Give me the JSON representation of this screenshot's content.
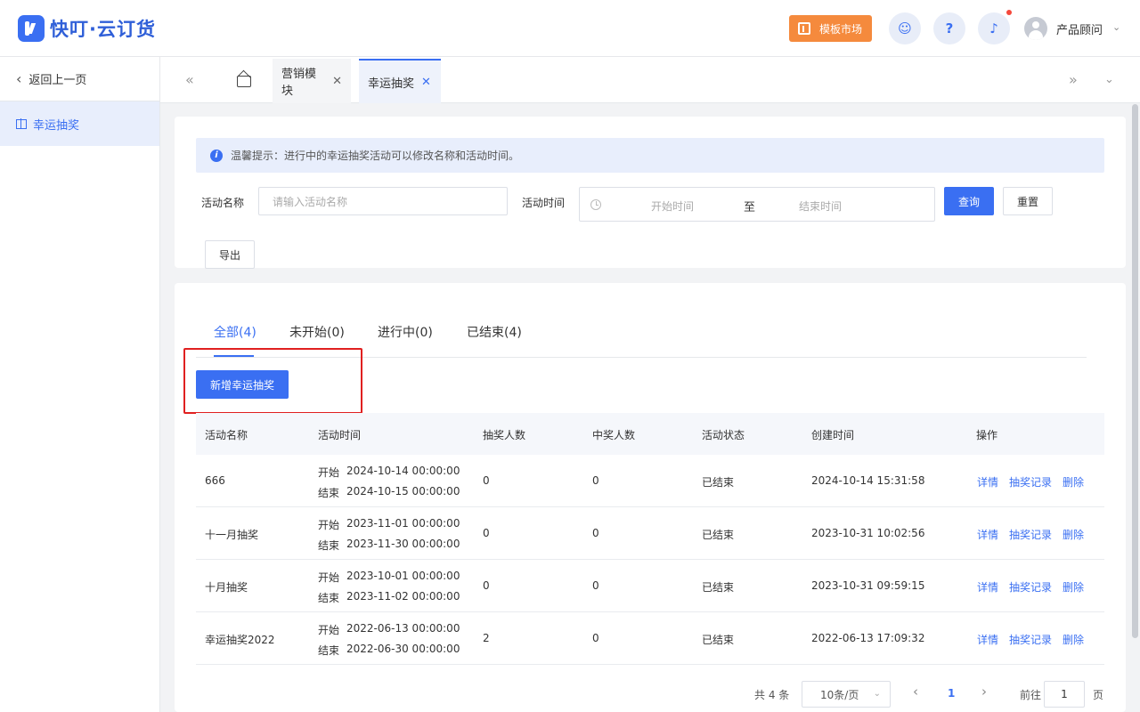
{
  "app": {
    "logo_text": "快叮·云订货",
    "market_button": "模板市场",
    "user_name": "产品顾问"
  },
  "sidebar": {
    "back_label": "返回上一页",
    "items": [
      {
        "label": "幸运抽奖",
        "icon": "gift-icon"
      }
    ]
  },
  "tabs": [
    {
      "label": "营销模块"
    },
    {
      "label": "幸运抽奖"
    }
  ],
  "filter": {
    "notice": "温馨提示：进行中的幸运抽奖活动可以修改名称和活动时间。",
    "name_label": "活动名称",
    "name_placeholder": "请输入活动名称",
    "time_label": "活动时间",
    "start_placeholder": "开始时间",
    "range_separator": "至",
    "end_placeholder": "结束时间",
    "search_button": "查询",
    "reset_button": "重置",
    "export_button": "导出"
  },
  "status_tabs": [
    {
      "label": "全部(4)"
    },
    {
      "label": "未开始(0)"
    },
    {
      "label": "进行中(0)"
    },
    {
      "label": "已结束(4)"
    }
  ],
  "add_button": "新增幸运抽奖",
  "table": {
    "columns": [
      "活动名称",
      "活动时间",
      "抽奖人数",
      "中奖人数",
      "活动状态",
      "创建时间",
      "操作"
    ],
    "start_prefix": "开始",
    "end_prefix": "结束",
    "actions": {
      "detail": "详情",
      "records": "抽奖记录",
      "delete": "删除"
    },
    "rows": [
      {
        "name": "666",
        "start": "2024-10-14 00:00:00",
        "end": "2024-10-15 00:00:00",
        "draw_count": "0",
        "win_count": "0",
        "status": "已结束",
        "created": "2024-10-14 15:31:58"
      },
      {
        "name": "十一月抽奖",
        "start": "2023-11-01 00:00:00",
        "end": "2023-11-30 00:00:00",
        "draw_count": "0",
        "win_count": "0",
        "status": "已结束",
        "created": "2023-10-31 10:02:56"
      },
      {
        "name": "十月抽奖",
        "start": "2023-10-01 00:00:00",
        "end": "2023-11-02 00:00:00",
        "draw_count": "0",
        "win_count": "0",
        "status": "已结束",
        "created": "2023-10-31 09:59:15"
      },
      {
        "name": "幸运抽奖2022",
        "start": "2022-06-13 00:00:00",
        "end": "2022-06-30 00:00:00",
        "draw_count": "2",
        "win_count": "0",
        "status": "已结束",
        "created": "2022-06-13 17:09:32"
      }
    ]
  },
  "pagination": {
    "total": "共 4 条",
    "page_size": "10条/页",
    "current_page": "1",
    "goto_label": "前往",
    "goto_value": "1",
    "page_suffix": "页"
  },
  "colors": {
    "primary": "#3a6ff2",
    "market": "#f58a3d",
    "highlight_box": "#e02020"
  }
}
